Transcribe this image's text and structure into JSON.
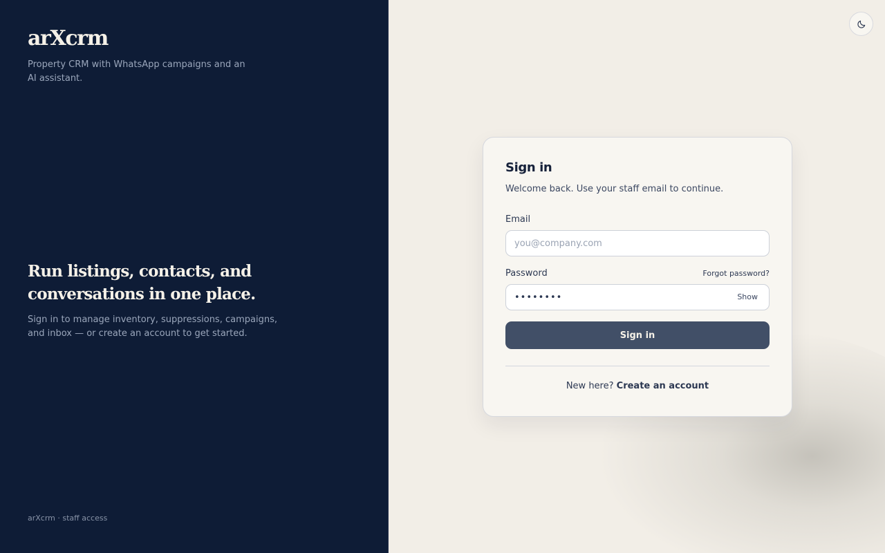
{
  "brand": {
    "name": "arXcrm",
    "tagline": "Property CRM with WhatsApp campaigns and an AI assistant."
  },
  "hero": {
    "headline": "Run listings, contacts, and conversations in one place.",
    "subline": "Sign in to manage inventory, suppressions, campaigns, and inbox — or create an account to get started."
  },
  "footer": {
    "note": "arXcrm · staff access"
  },
  "theme_toggle": {
    "icon": "moon-icon"
  },
  "signin": {
    "title": "Sign in",
    "subtitle": "Welcome back. Use your staff email to continue.",
    "email_label": "Email",
    "email_placeholder": "you@company.com",
    "email_value": "",
    "password_label": "Password",
    "forgot_label": "Forgot password?",
    "password_value": "••••••••",
    "show_label": "Show",
    "submit_label": "Sign in",
    "signup_prompt": "New here?",
    "signup_link": "Create an account"
  },
  "colors": {
    "left_panel_bg": "#0e1c36",
    "right_panel_bg": "#f2eee7",
    "primary_button": "#414f67"
  }
}
